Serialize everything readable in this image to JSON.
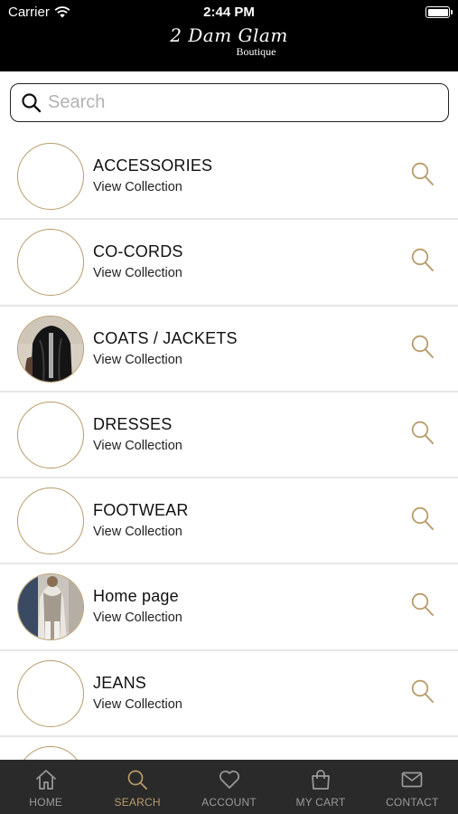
{
  "status_bar": {
    "carrier": "Carrier",
    "time": "2:44 PM"
  },
  "header": {
    "logo_script": "2 Dam Glam",
    "logo_sub": "Boutique"
  },
  "search": {
    "placeholder": "Search",
    "value": ""
  },
  "colors": {
    "accent": "#b89c6a",
    "header_bg": "#000000",
    "tabbar_bg": "#2a2a2a",
    "tab_inactive": "#9a9a9a"
  },
  "collections": [
    {
      "title": "ACCESSORIES",
      "subtitle": "View Collection",
      "image": "none"
    },
    {
      "title": "CO-CORDS",
      "subtitle": "View Collection",
      "image": "none"
    },
    {
      "title": "COATS / JACKETS",
      "subtitle": "View Collection",
      "image": "black-jacket-photo"
    },
    {
      "title": "DRESSES",
      "subtitle": "View Collection",
      "image": "none"
    },
    {
      "title": "FOOTWEAR",
      "subtitle": "View Collection",
      "image": "none"
    },
    {
      "title": "Home page",
      "subtitle": "View Collection",
      "image": "outfit-photo"
    },
    {
      "title": "JEANS",
      "subtitle": "View Collection",
      "image": "none"
    },
    {
      "title": "",
      "subtitle": "",
      "image": "none"
    }
  ],
  "tabs": [
    {
      "label": "HOME",
      "icon": "home-icon",
      "active": false
    },
    {
      "label": "SEARCH",
      "icon": "search-icon",
      "active": true
    },
    {
      "label": "ACCOUNT",
      "icon": "heart-icon",
      "active": false
    },
    {
      "label": "MY CART",
      "icon": "shopping-bag-icon",
      "active": false
    },
    {
      "label": "CONTACT",
      "icon": "mail-icon",
      "active": false
    }
  ]
}
